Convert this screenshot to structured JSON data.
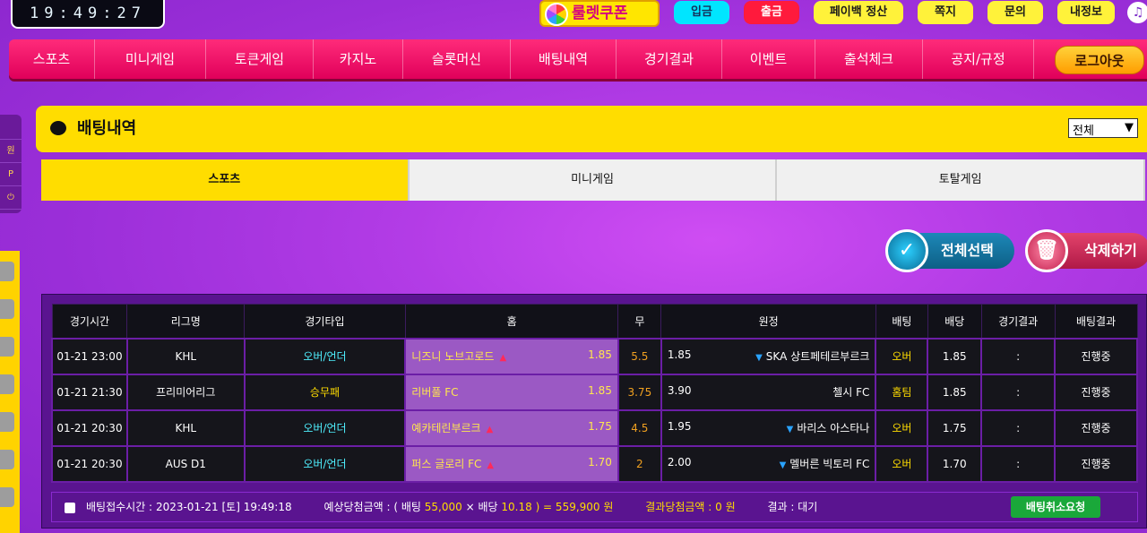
{
  "clock": "19:49:27",
  "topbar": {
    "coupon": "룰렛쿠폰",
    "buttons": [
      "입금",
      "출금",
      "페이백 정산",
      "쪽지",
      "문의",
      "내정보"
    ]
  },
  "nav": {
    "items": [
      "스포츠",
      "미니게임",
      "토큰게임",
      "카지노",
      "슬롯머신",
      "배팅내역",
      "경기결과",
      "이벤트",
      "출석체크",
      "공지/규정"
    ],
    "logout": "로그아웃"
  },
  "sidebar": {
    "labels": [
      "원",
      "P",
      "⏻"
    ]
  },
  "page": {
    "title": "배팅내역",
    "filter_selected": "전체"
  },
  "tabs": [
    "스포츠",
    "미니게임",
    "토탈게임"
  ],
  "actions": {
    "select_all": "전체선택",
    "delete": "삭제하기"
  },
  "table": {
    "headers": [
      "경기시간",
      "리그명",
      "경기타입",
      "홈",
      "무",
      "원정",
      "배팅",
      "배당",
      "경기결과",
      "배팅결과"
    ],
    "rows": [
      {
        "time": "01-21 23:00",
        "league": "KHL",
        "type": "오버/언더",
        "home": "니즈니 노브고로드",
        "home_odds": "1.85",
        "draw": "5.5",
        "away_odds": "1.85",
        "away": "SKA 상트페테르부르크",
        "bet": "오버",
        "odds": "1.85",
        "result": ":",
        "status": "진행중"
      },
      {
        "time": "01-21 21:30",
        "league": "프리미어리그",
        "type": "승무패",
        "home": "리버풀 FC",
        "home_odds": "1.85",
        "draw": "3.75",
        "away_odds": "3.90",
        "away": "첼시 FC",
        "bet": "홈팀",
        "odds": "1.85",
        "result": ":",
        "status": "진행중"
      },
      {
        "time": "01-21 20:30",
        "league": "KHL",
        "type": "오버/언더",
        "home": "예카테린부르크",
        "home_odds": "1.75",
        "draw": "4.5",
        "away_odds": "1.95",
        "away": "바리스 아스타나",
        "bet": "오버",
        "odds": "1.75",
        "result": ":",
        "status": "진행중"
      },
      {
        "time": "01-21 20:30",
        "league": "AUS D1",
        "type": "오버/언더",
        "home": "퍼스 글로리 FC",
        "home_odds": "1.70",
        "draw": "2",
        "away_odds": "2.00",
        "away": "멜버른 빅토리 FC",
        "bet": "오버",
        "odds": "1.70",
        "result": ":",
        "status": "진행중"
      }
    ]
  },
  "summary": {
    "time_label": "배팅접수시간 :",
    "time_value": "2023-01-21 [토] 19:49:18",
    "expected_label": "예상당첨금액 : ( 배팅",
    "stake": "55,000",
    "times": "× 배당",
    "total_odds": "10.18",
    "payout": ") = 559,900 원",
    "result_amount": "결과당첨금액 : 0 원",
    "result": "결과 : 대기",
    "cancel": "배팅취소요청"
  },
  "colors": {
    "accent_yellow": "#ffdd00",
    "nav_pink": "#ff2b7a",
    "bg_purple": "#b33ce6"
  }
}
